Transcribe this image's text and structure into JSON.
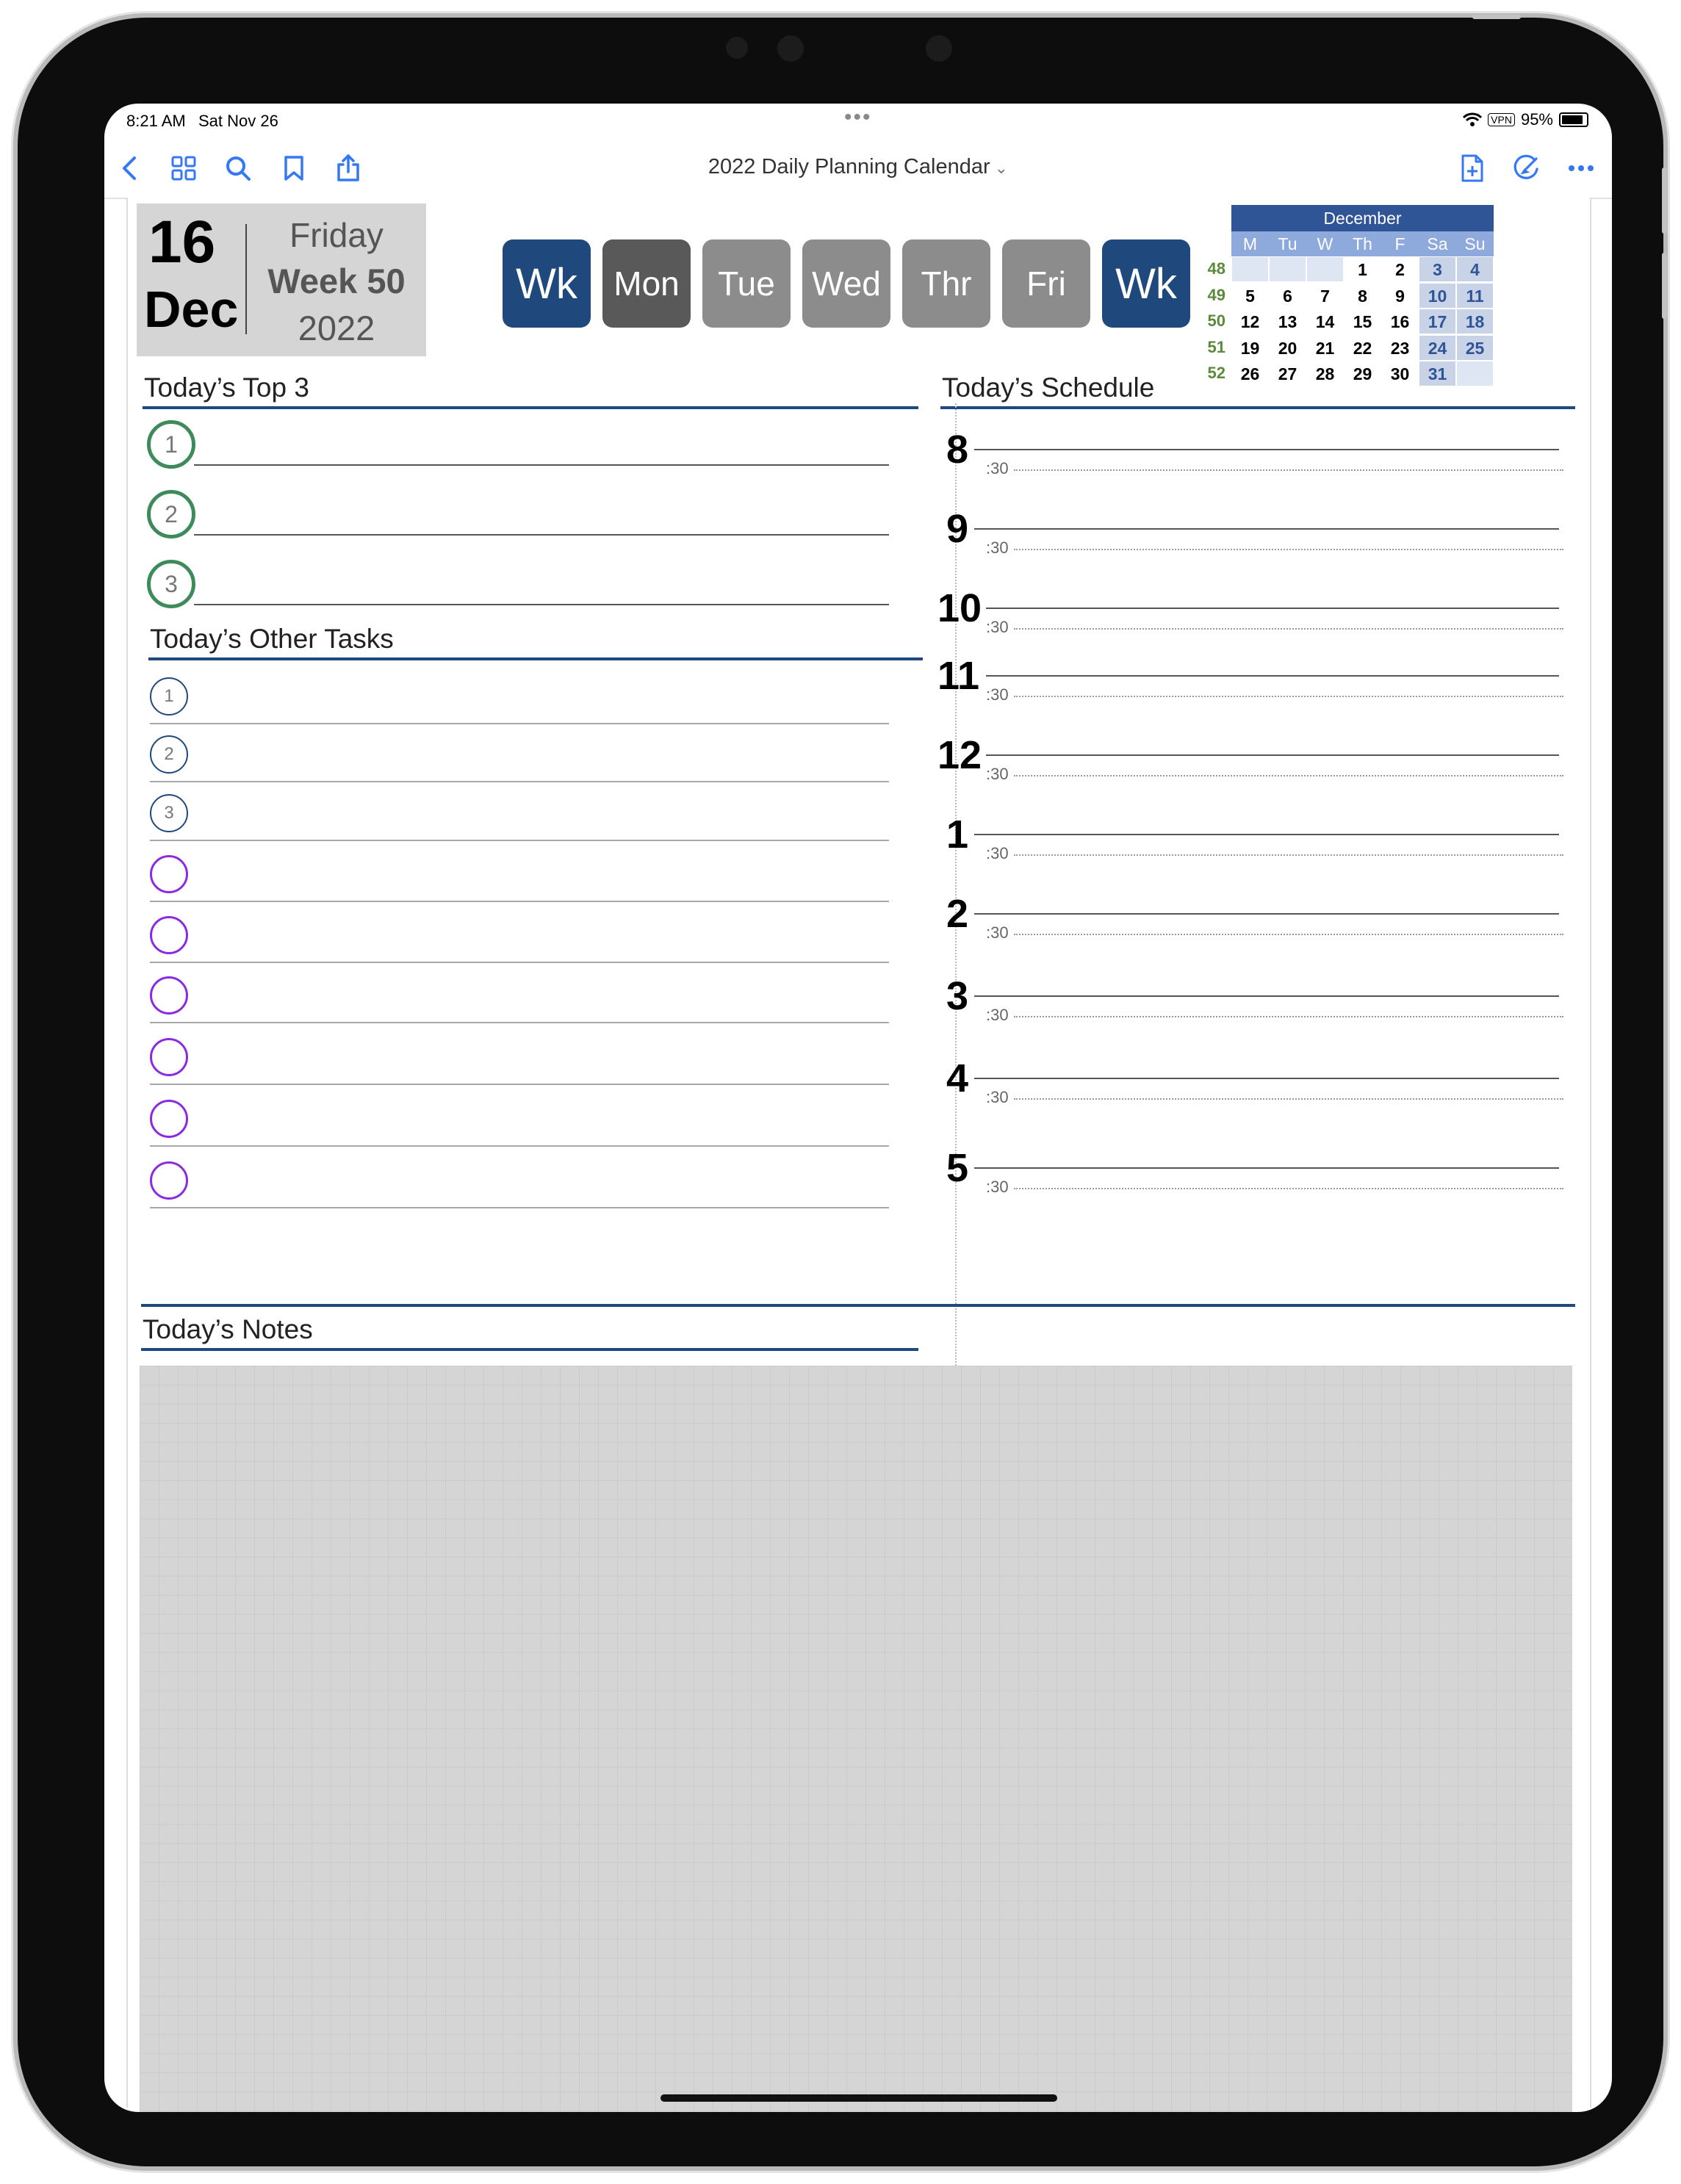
{
  "status_bar": {
    "time": "8:21 AM",
    "date": "Sat Nov 26",
    "dots": "•••",
    "vpn": "VPN",
    "battery": "95%",
    "battery_level": 0.95
  },
  "toolbar": {
    "title": "2022 Daily Planning Calendar",
    "icons": [
      "back-icon",
      "grid-icon",
      "search-icon",
      "bookmark-icon",
      "share-icon",
      "add-page-icon",
      "pen-icon",
      "more-icon"
    ],
    "accent": "#3478f6"
  },
  "date_block": {
    "day": "16",
    "month": "Dec",
    "weekday": "Friday",
    "week": "Week 50",
    "year": "2022"
  },
  "nav": [
    "Wk",
    "Mon",
    "Tue",
    "Wed",
    "Thr",
    "Fri",
    "Wk"
  ],
  "mini_calendar": {
    "month": "December",
    "days_of_week": [
      "M",
      "Tu",
      "W",
      "Th",
      "F",
      "Sa",
      "Su"
    ],
    "weeks": [
      {
        "num": "48",
        "days": [
          "",
          "",
          "",
          "1",
          "2",
          "3",
          "4"
        ]
      },
      {
        "num": "49",
        "days": [
          "5",
          "6",
          "7",
          "8",
          "9",
          "10",
          "11"
        ]
      },
      {
        "num": "50",
        "days": [
          "12",
          "13",
          "14",
          "15",
          "16",
          "17",
          "18"
        ]
      },
      {
        "num": "51",
        "days": [
          "19",
          "20",
          "21",
          "22",
          "23",
          "24",
          "25"
        ]
      },
      {
        "num": "52",
        "days": [
          "26",
          "27",
          "28",
          "29",
          "30",
          "31",
          ""
        ]
      }
    ]
  },
  "top3": {
    "title": "Today’s Top 3",
    "items": [
      "1",
      "2",
      "3"
    ]
  },
  "other_tasks": {
    "title": "Today’s Other Tasks",
    "numbered": [
      "1",
      "2",
      "3"
    ],
    "blank_count": 6
  },
  "schedule": {
    "title": "Today’s Schedule",
    "hours": [
      "8",
      "9",
      "10",
      "11",
      "12",
      "1",
      "2",
      "3",
      "4",
      "5"
    ],
    "half_label": ":30"
  },
  "notes": {
    "title": "Today’s Notes"
  },
  "colors": {
    "navy": "#1f497d",
    "green": "#3d8b5a",
    "purple": "#8a2be2",
    "gray_panel": "#d5d5d5"
  }
}
